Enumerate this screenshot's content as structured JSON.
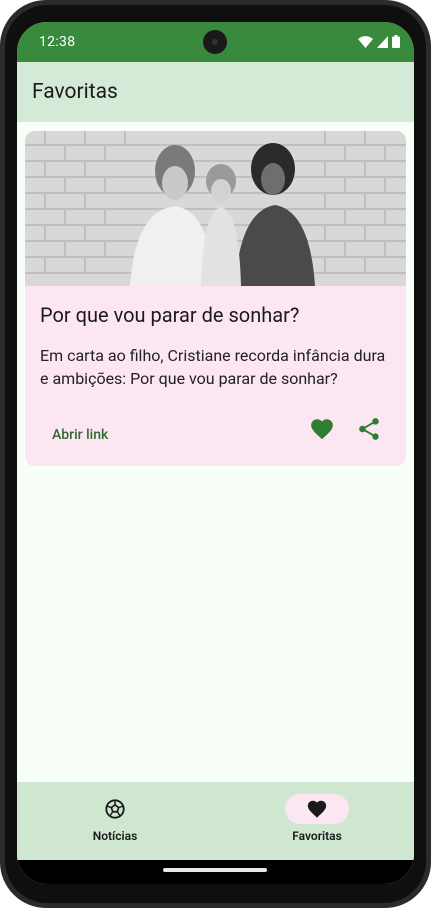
{
  "status_bar": {
    "time": "12:38"
  },
  "app_bar": {
    "title": "Favoritas"
  },
  "favorites": [
    {
      "title": "Por que vou parar de sonhar?",
      "summary": "Em carta ao filho, Cristiane recorda infância dura e ambições: Por que vou parar de sonhar?",
      "open_link_label": "Abrir link"
    }
  ],
  "bottom_nav": {
    "items": [
      {
        "label": "Notícias",
        "icon": "soccer-ball-icon",
        "active": false
      },
      {
        "label": "Favoritas",
        "icon": "heart-icon",
        "active": true
      }
    ]
  },
  "colors": {
    "status_bar": "#3a8a3e",
    "app_bar": "#d4ead6",
    "card_background": "#fce6f2",
    "accent": "#2e7d32",
    "bottom_nav": "#cfe7d0"
  }
}
